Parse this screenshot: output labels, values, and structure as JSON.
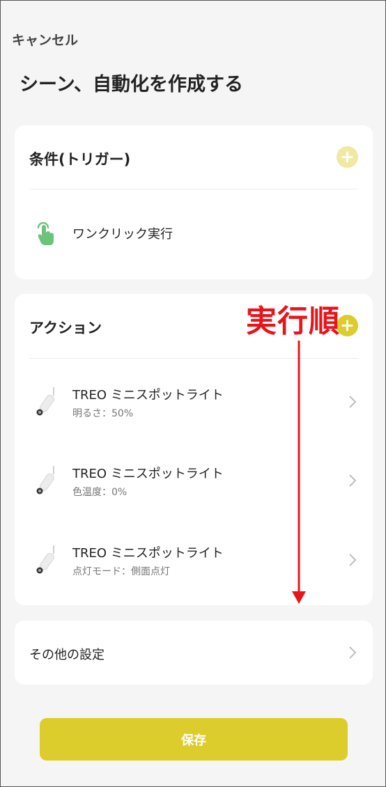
{
  "header": {
    "cancel_label": "キャンセル",
    "title": "シーン、自動化を作成する"
  },
  "condition": {
    "title": "条件(トリガー)",
    "items": [
      {
        "label": "ワンクリック実行",
        "icon": "tap-hand-icon"
      }
    ]
  },
  "action": {
    "title": "アクション",
    "items": [
      {
        "title": "TREO ミニスポットライト",
        "subtitle": "明るさ：50%",
        "icon": "spotlight-icon"
      },
      {
        "title": "TREO ミニスポットライト",
        "subtitle": "色温度：0%",
        "icon": "spotlight-icon"
      },
      {
        "title": "TREO ミニスポットライト",
        "subtitle": "点灯モード：側面点灯",
        "icon": "spotlight-icon"
      }
    ]
  },
  "other": {
    "label": "その他の設定"
  },
  "footer": {
    "save_label": "保存"
  },
  "annotation": {
    "label": "実行順"
  },
  "colors": {
    "accent": "#dccd2c",
    "accent_light": "#efe9a3",
    "annotation": "#e8141a",
    "tap_icon": "#6cc47a"
  }
}
